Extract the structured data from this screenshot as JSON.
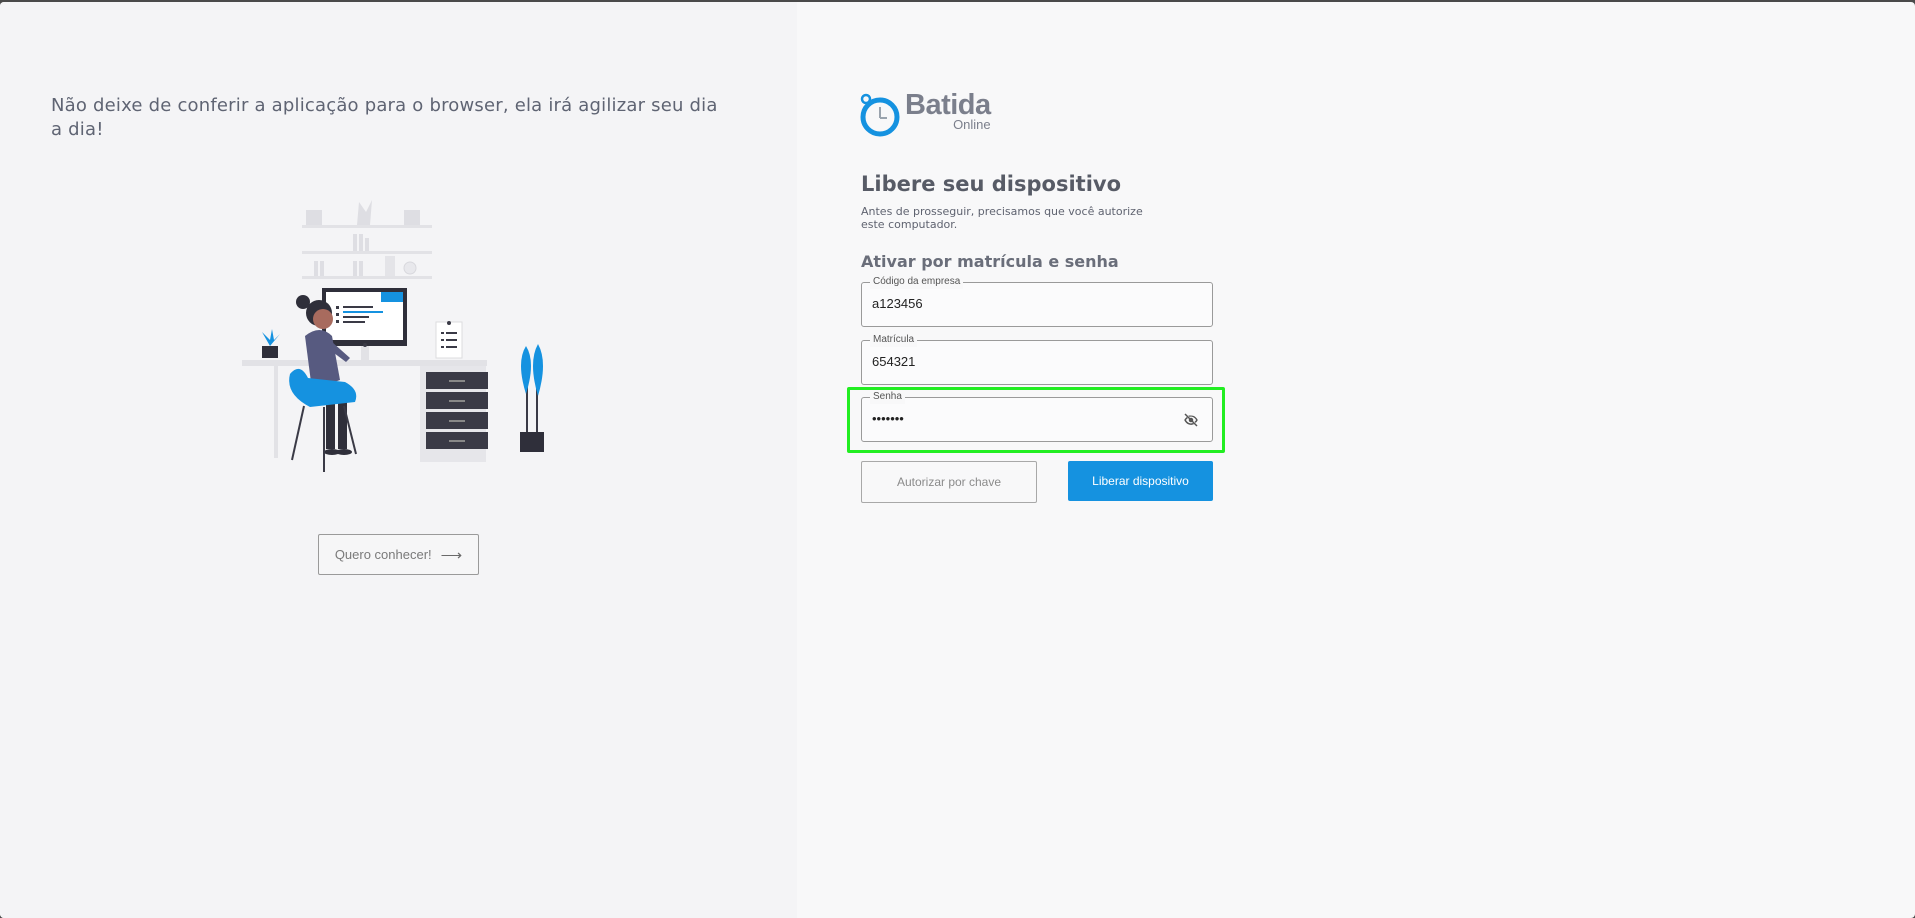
{
  "promo": {
    "text": "Não deixe de conferir a aplicação para o browser, ela irá agilizar seu dia a dia!",
    "button_label": "Quero conhecer!"
  },
  "logo": {
    "name": "Batida",
    "sub": "Online"
  },
  "auth": {
    "title": "Libere seu dispositivo",
    "subtitle": "Antes de prosseguir, precisamos que você autorize este computador.",
    "section_title": "Ativar por matrícula e senha",
    "company_code": {
      "label": "Código da empresa",
      "value": "a123456"
    },
    "registration": {
      "label": "Matrícula",
      "value": "654321"
    },
    "password": {
      "label": "Senha",
      "value": "•••••••"
    },
    "key_button": "Autorizar por chave",
    "release_button": "Liberar dispositivo"
  },
  "icons": {
    "arrow": "arrow-right-icon",
    "eye": "eye-off-icon",
    "logo": "clock-icon"
  },
  "colors": {
    "accent": "#1592e0",
    "highlight": "#22ee22",
    "logo_text": "#7b7f8c"
  }
}
